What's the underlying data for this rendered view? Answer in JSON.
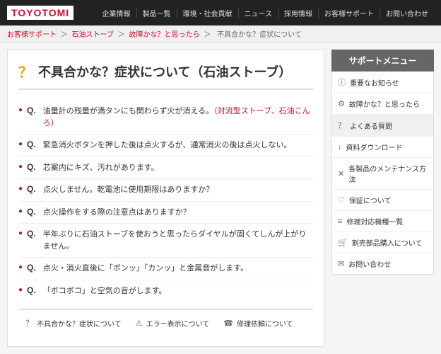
{
  "header": {
    "logo": "TOYOTOMI",
    "nav": [
      {
        "label": "企業情報"
      },
      {
        "label": "製品一覧"
      },
      {
        "label": "環境・社会貢献"
      },
      {
        "label": "ニュース"
      },
      {
        "label": "採用情報"
      },
      {
        "label": "お客様サポート"
      },
      {
        "label": "お問い合わせ"
      }
    ]
  },
  "breadcrumb": {
    "items": [
      {
        "label": "お客様サポート",
        "link": true
      },
      {
        "label": "石油ストーブ",
        "link": true
      },
      {
        "label": "故障かな？と思ったら",
        "link": true
      },
      {
        "label": "不具合かな？症状について",
        "link": false
      }
    ],
    "separator": "＞"
  },
  "page": {
    "title_icon": "?",
    "title": "不具合かな？症状について（石油ストーブ）",
    "faq_items": [
      {
        "q": "Q.",
        "text": "油量計の残量が満タンにも関わらず火が消える。（対流型ストーブ、石油こんろ）",
        "has_link": true,
        "link_text": "（対流型ストーブ、石油こんろ）"
      },
      {
        "q": "Q.",
        "text": "緊急消火ボタンを押した後は点火するが、通常消火の後は点火しない。",
        "has_link": false
      },
      {
        "q": "Q.",
        "text": "芯案内にキズ、汚れがあります。",
        "has_link": false
      },
      {
        "q": "Q.",
        "text": "点火しません。乾電池に使用期限はありますか？",
        "has_link": false
      },
      {
        "q": "Q.",
        "text": "点火操作をする際の注意点はありますか？",
        "has_link": false
      },
      {
        "q": "Q.",
        "text": "半年ぶりに石油ストーブを使おうと思ったらダイヤルが固くてしんが上がりません。",
        "has_link": false
      },
      {
        "q": "Q.",
        "text": "点火・消火直後に「ボンッ」「カンッ」と金属音がします。",
        "has_link": false
      },
      {
        "q": "Q.",
        "text": "「ボコボコ」と空気の音がします。",
        "has_link": false
      }
    ]
  },
  "sidebar": {
    "title": "サポートメニュー",
    "items": [
      {
        "icon": "ⓘ",
        "label": "重要なお知らせ"
      },
      {
        "icon": "⚙",
        "label": "故障かな？と思ったら"
      },
      {
        "icon": "?",
        "label": "よくある質問"
      },
      {
        "icon": "↓",
        "label": "資料ダウンロード"
      },
      {
        "icon": "✕",
        "label": "各製品のメンテナンス方法"
      },
      {
        "icon": "♡",
        "label": "保証について"
      },
      {
        "icon": "≡",
        "label": "修理対応機種一覧"
      },
      {
        "icon": "🛒",
        "label": "割売部品購入について"
      },
      {
        "icon": "✉",
        "label": "お問い合わせ"
      }
    ]
  },
  "footer_nav": {
    "items": [
      {
        "icon": "?",
        "label": "不具合かな？症状について"
      },
      {
        "icon": "⚠",
        "label": "エラー表示について"
      },
      {
        "icon": "☎",
        "label": "修理依頼について"
      }
    ]
  }
}
